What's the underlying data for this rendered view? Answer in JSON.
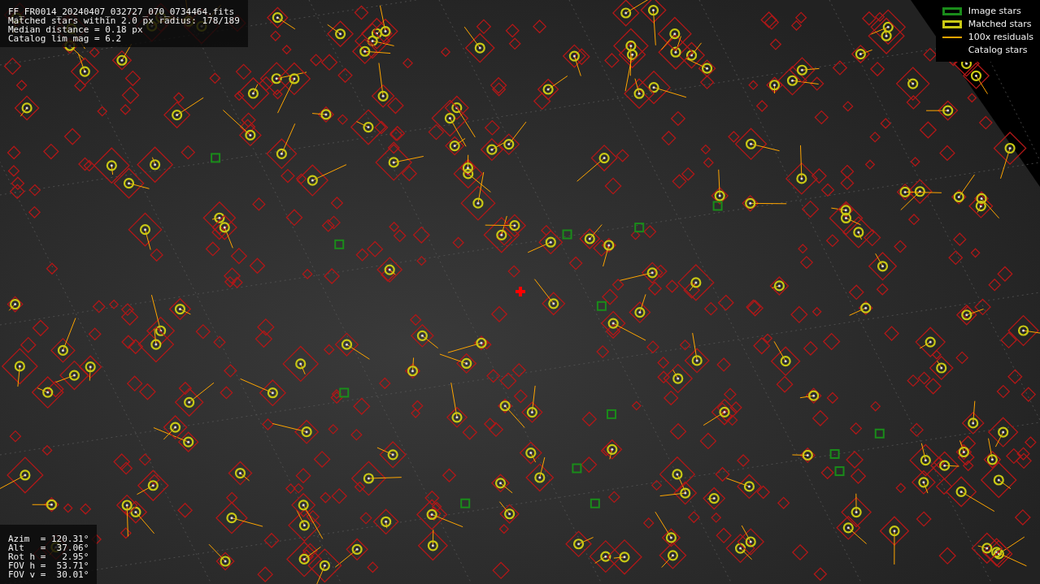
{
  "info_box": {
    "lines": [
      "FF_FR0014_20240407_032727_070_0734464.fits",
      "Matched stars within 2.0 px radius: 178/189",
      "Median distance = 0.18 px",
      "Catalog lim mag = 6.2"
    ]
  },
  "legend": [
    {
      "label": "Image stars",
      "kind": "box",
      "color": "#1a8c1a"
    },
    {
      "label": "Matched stars",
      "kind": "box",
      "color": "#c8c814"
    },
    {
      "label": "100x residuals",
      "kind": "line",
      "color": "#ffa500"
    },
    {
      "label": "Catalog stars",
      "kind": "none"
    }
  ],
  "pointing_box": {
    "lines": [
      "Azim  = 120.31°",
      "Alt   =  37.06°",
      "Rot h =   2.95°",
      "FOV h =  53.71°",
      "FOV v =  30.01°"
    ]
  }
}
